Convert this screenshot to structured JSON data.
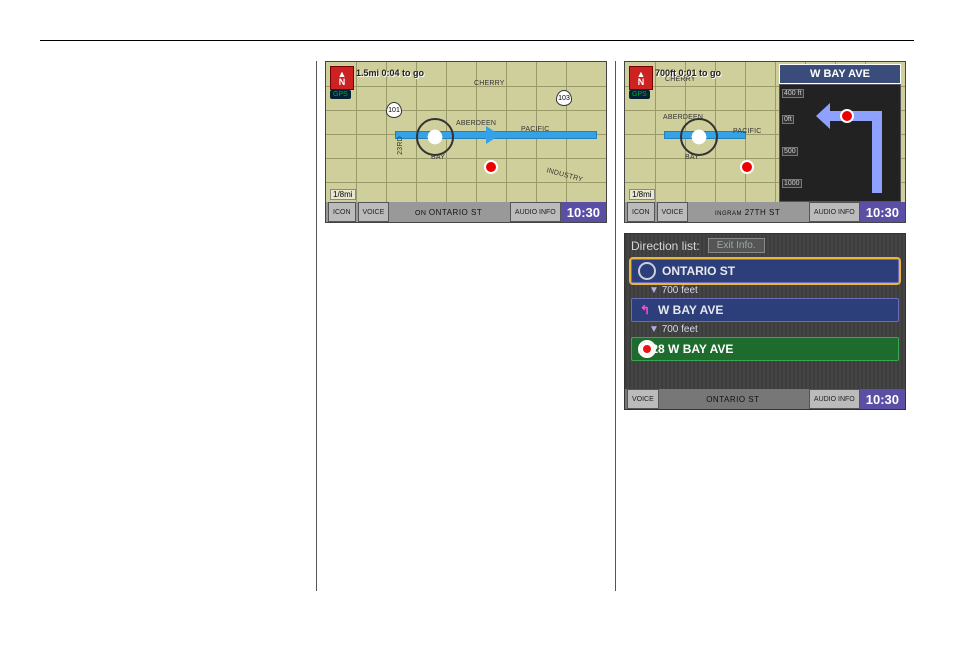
{
  "nav1": {
    "compass": "N",
    "gps": "GPS",
    "to_go": "1.5mi 0:04 to go",
    "scale": "1/8mi",
    "street": "ONTARIO ST",
    "labels": {
      "cherry": "CHERRY",
      "aberdeen": "ABERDEEN",
      "pacific": "PACIFIC",
      "bay": "BAY",
      "r23rd": "23RD",
      "industry": "INDUSTRY"
    },
    "shields": {
      "a": "101",
      "b": "103"
    },
    "clock": "10:30",
    "btn_icon": "ICON",
    "btn_voice": "VOICE",
    "btn_audio": "AUDIO INFO"
  },
  "nav2": {
    "compass": "N",
    "gps": "GPS",
    "to_go": "700ft 0:01 to go",
    "banner": "W BAY AVE",
    "scale": "1/8mi",
    "street": "27TH ST",
    "prefix": "INGRAM",
    "labels": {
      "cherry": "CHERRY",
      "aberdeen": "ABERDEEN",
      "pacific": "PACIFIC",
      "bay": "BAY"
    },
    "ap_scale": {
      "a": "400 ft",
      "b": "0ft",
      "c": "500",
      "d": "1000"
    },
    "clock": "10:30",
    "btn_icon": "ICON",
    "btn_voice": "VOICE",
    "btn_audio": "AUDIO INFO"
  },
  "dlist": {
    "title": "Direction list:",
    "exit": "Exit Info.",
    "items": [
      {
        "label": "ONTARIO ST"
      },
      {
        "label": "W BAY AVE"
      },
      {
        "label": "2728 W BAY AVE"
      }
    ],
    "dist": [
      "700 feet",
      "700 feet"
    ],
    "street": "ONTARIO ST",
    "clock": "10:30",
    "btn_voice": "VOICE",
    "btn_audio": "AUDIO INFO"
  }
}
